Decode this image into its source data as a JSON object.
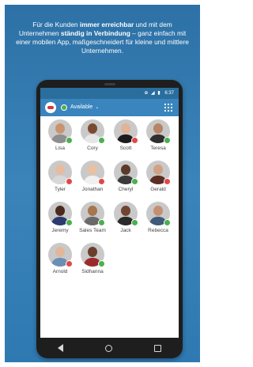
{
  "headline": {
    "part1": "Für die Kunden ",
    "bold1": "immer erreichbar",
    "part2": " und mit dem Unternehmen ",
    "bold2": "ständig in Verbindung",
    "part3": " – ganz einfach mit einer mobilen App, maßgeschneidert für kleine und mittlere Unternehmen."
  },
  "status_bar": {
    "icons": "⊕ ◢ ▮",
    "time": "6:37"
  },
  "app_bar": {
    "presence_label": "Available",
    "presence_color": "#4caf50",
    "grid_icon": "apps-grid-icon"
  },
  "contacts": [
    {
      "name": "Lisa",
      "status": "available",
      "skin": "#c8946f",
      "shirt": "#8e8e8e"
    },
    {
      "name": "Cory",
      "status": "available",
      "skin": "#7b4a2f",
      "shirt": "#e6e6e6"
    },
    {
      "name": "Scott",
      "status": "busy",
      "skin": "#e2b394",
      "shirt": "#1c1c1c"
    },
    {
      "name": "Teresa",
      "status": "available",
      "skin": "#b88466",
      "shirt": "#2f2f2f"
    },
    {
      "name": "Tyler",
      "status": "busy",
      "skin": "#e6bba0",
      "shirt": "#d8d8d8"
    },
    {
      "name": "Jonathan",
      "status": "busy",
      "skin": "#e8c0a2",
      "shirt": "#f0f0f0"
    },
    {
      "name": "Cheryl",
      "status": "available",
      "skin": "#5b3a2a",
      "shirt": "#3a3a3a"
    },
    {
      "name": "Gerald",
      "status": "busy",
      "skin": "#d2a183",
      "shirt": "#5a2e24"
    },
    {
      "name": "Jeremy",
      "status": "available",
      "skin": "#4a2a1c",
      "shirt": "#2c3b6e"
    },
    {
      "name": "Sales Team",
      "status": "available",
      "skin": "#a5764f",
      "shirt": "#6a6a6a"
    },
    {
      "name": "Jack",
      "status": "available",
      "skin": "#6f4532",
      "shirt": "#2a2a2a"
    },
    {
      "name": "Rebecca",
      "status": "available",
      "skin": "#c59072",
      "shirt": "#3f5a7a"
    },
    {
      "name": "Arnold",
      "status": "busy",
      "skin": "#e0b79a",
      "shirt": "#6b8fb4"
    },
    {
      "name": "Sidhanna",
      "status": "available",
      "skin": "#6a3f2d",
      "shirt": "#9b2b2b"
    }
  ],
  "nav": {
    "back_icon": "back-triangle-icon",
    "home_icon": "home-circle-icon",
    "recents_icon": "recents-square-icon"
  }
}
